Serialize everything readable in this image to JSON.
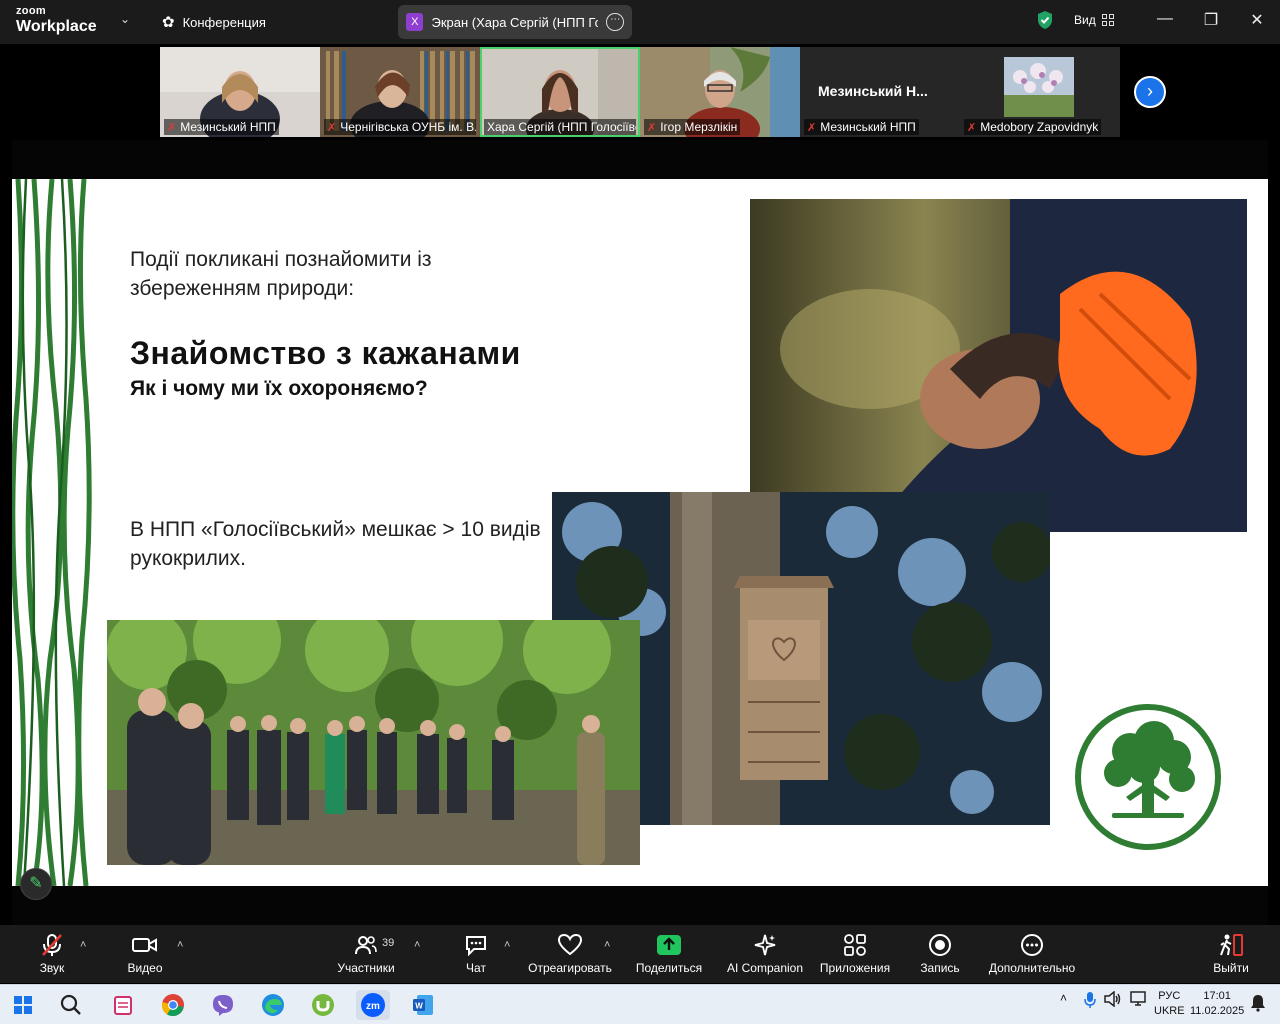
{
  "titlebar": {
    "brand_small": "zoom",
    "brand_big": "Workplace",
    "conference_label": "Конференция",
    "screen_tab_badge": "X",
    "screen_tab_label": "Экран (Хара Сергій (НПП Голосіївський))",
    "view_label": "Вид"
  },
  "participants": [
    {
      "name": "Мезинський НПП",
      "muted": true
    },
    {
      "name": "Чернігівська ОУНБ ім. В. Короленка",
      "muted": true
    },
    {
      "name": "Хара Сергій (НПП Голосіївський)",
      "muted": false,
      "active": true
    },
    {
      "name": "Ігор Мерзлікін",
      "muted": true
    },
    {
      "name": "Мезинський НПП",
      "muted": true,
      "tile_text": "Мезинський Н..."
    },
    {
      "name": "Medobory Zapovidnyk",
      "muted": true
    }
  ],
  "slide": {
    "intro": "Події покликані познайомити із збереженням природи:",
    "heading": "Знайомство з кажанами",
    "subheading": "Як і чому ми їх охороняємо?",
    "fact": "В НПП «Голосіївський» мешкає > 10 видів рукокрилих."
  },
  "toolbar": {
    "audio": "Звук",
    "video": "Видео",
    "participants": "Участники",
    "participants_count": "39",
    "chat": "Чат",
    "react": "Отреагировать",
    "share": "Поделиться",
    "ai": "AI Companion",
    "apps": "Приложения",
    "record": "Запись",
    "more": "Дополнительно",
    "leave": "Выйти"
  },
  "taskbar": {
    "lang_top": "РУС",
    "lang_bottom": "UKRE",
    "time": "17:01",
    "date": "11.02.2025",
    "zoom_label": "zm",
    "word_label": "W"
  },
  "colors": {
    "accent_green": "#2e7d32",
    "zoom_blue": "#0b5cff",
    "active_outline": "#4ad16c"
  }
}
